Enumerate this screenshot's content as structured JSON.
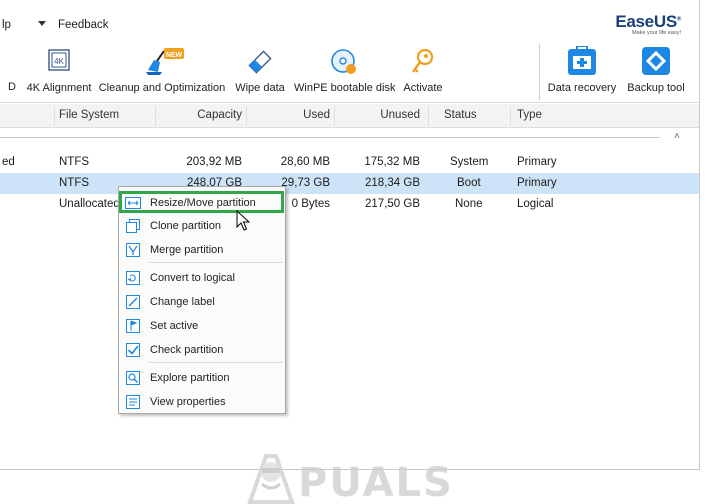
{
  "menubar": {
    "help_fragment": "lp",
    "feedback": "Feedback"
  },
  "brand": {
    "name_part1": "Ease",
    "name_part2": "US",
    "tagline": "Make your life easy!"
  },
  "toolbar": {
    "left_fragment": "D",
    "tools": [
      {
        "label": "4K Alignment",
        "icon": "4k-alignment-icon"
      },
      {
        "label": "Cleanup and Optimization",
        "icon": "cleanup-broom-icon",
        "badge": "NEW"
      },
      {
        "label": "Wipe data",
        "icon": "eraser-icon"
      },
      {
        "label": "WinPE bootable disk",
        "icon": "bootable-disc-icon"
      },
      {
        "label": "Activate",
        "icon": "key-icon"
      },
      {
        "label": "Data recovery",
        "icon": "data-recovery-kit-icon"
      },
      {
        "label": "Backup tool",
        "icon": "backup-tool-icon"
      }
    ]
  },
  "table": {
    "headers": [
      "File System",
      "Capacity",
      "Used",
      "Unused",
      "Status",
      "Type"
    ],
    "rows": [
      {
        "partition_fragment": "ed",
        "file_system": "NTFS",
        "capacity": "203,92 MB",
        "used": "28,60 MB",
        "unused": "175,32 MB",
        "status": "System",
        "type": "Primary"
      },
      {
        "partition_fragment": "",
        "file_system": "NTFS",
        "capacity": "248,07 GB",
        "used": "29,73 GB",
        "unused": "218,34 GB",
        "status": "Boot",
        "type": "Primary"
      },
      {
        "partition_fragment": "",
        "file_system": "Unallocated",
        "capacity": "",
        "used": "0 Bytes",
        "unused": "217,50 GB",
        "status": "None",
        "type": "Logical"
      }
    ],
    "collapse_glyph": "˄"
  },
  "context_menu": {
    "items": [
      {
        "label": "Resize/Move partition",
        "icon": "resize-move-icon"
      },
      {
        "label": "Clone partition",
        "icon": "clone-icon"
      },
      {
        "label": "Merge partition",
        "icon": "merge-icon"
      },
      {
        "label": "Convert to logical",
        "icon": "convert-icon"
      },
      {
        "label": "Change label",
        "icon": "label-icon"
      },
      {
        "label": "Set active",
        "icon": "flag-icon"
      },
      {
        "label": "Check partition",
        "icon": "check-icon"
      },
      {
        "label": "Explore partition",
        "icon": "explore-icon"
      },
      {
        "label": "View properties",
        "icon": "properties-icon"
      }
    ],
    "highlight_color": "#2fa84a"
  },
  "watermark": {
    "text": "PUALS"
  },
  "colors": {
    "selected_row": "#cde3f7",
    "accent_blue": "#1e88e5",
    "accent_orange": "#f0a020"
  }
}
